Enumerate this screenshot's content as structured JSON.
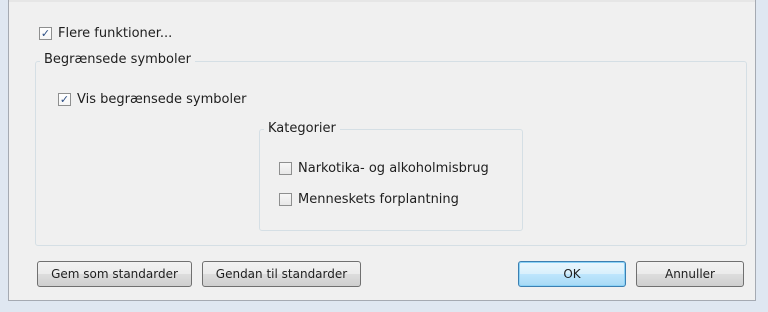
{
  "more_functions": {
    "label": "Flere funktioner...",
    "checked": true
  },
  "restricted_group": {
    "title": "Begrænsede symboler",
    "show_restricted": {
      "label": "Vis begrænsede symboler",
      "checked": true
    },
    "categories": {
      "title": "Kategorier",
      "items": [
        {
          "label": "Narkotika- og alkoholmisbrug",
          "checked": false
        },
        {
          "label": "Menneskets forplantning",
          "checked": false
        }
      ]
    }
  },
  "buttons": {
    "save_default": "Gem som standarder",
    "restore_default": "Gendan til standarder",
    "ok": "OK",
    "cancel": "Annuller"
  },
  "check_glyph": "✓"
}
